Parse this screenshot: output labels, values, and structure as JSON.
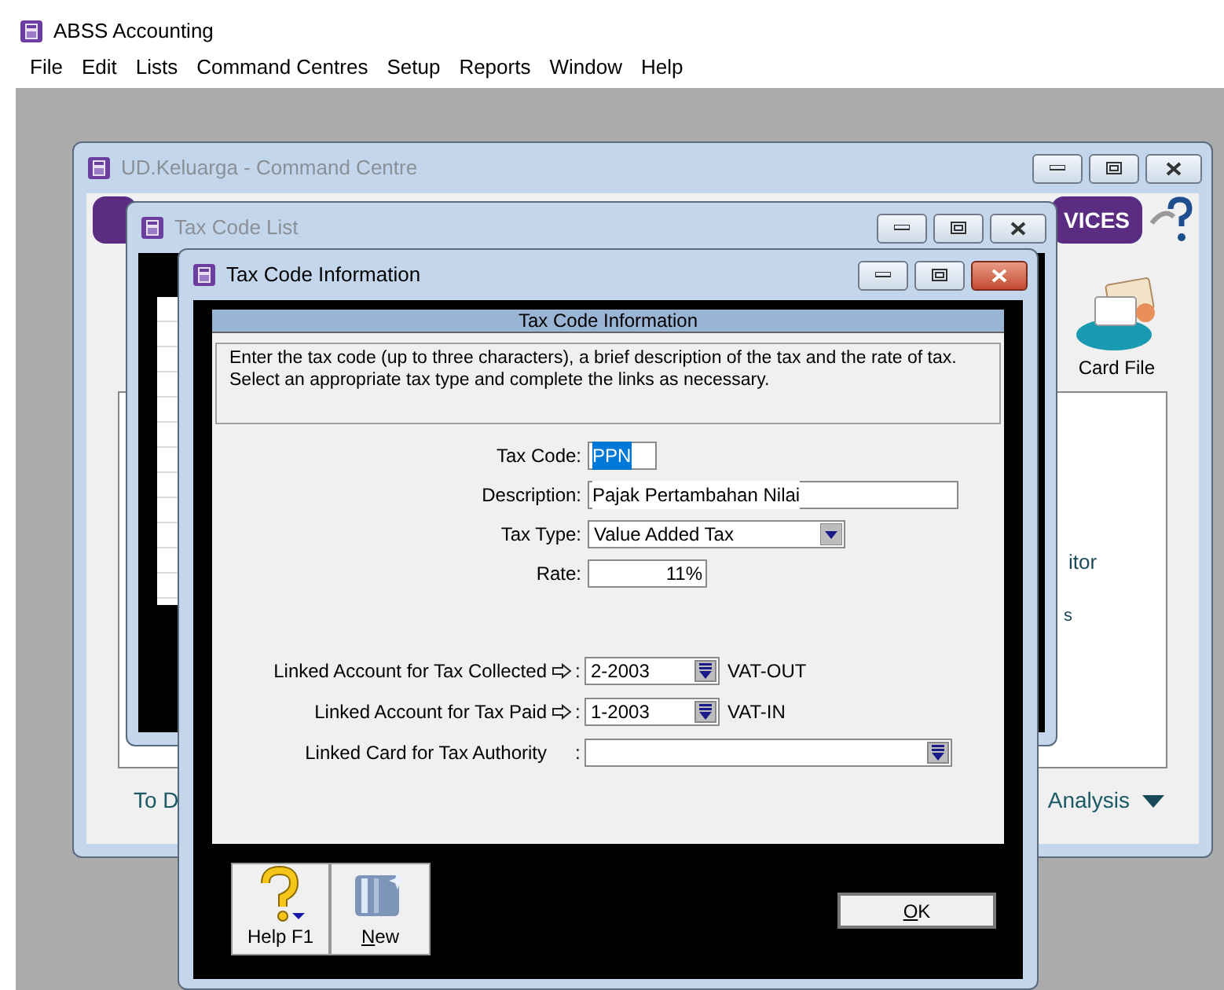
{
  "app": {
    "title": "ABSS Accounting"
  },
  "menu": [
    {
      "label": "File"
    },
    {
      "label": "Edit"
    },
    {
      "label": "Lists"
    },
    {
      "label": "Command Centres"
    },
    {
      "label": "Setup"
    },
    {
      "label": "Reports"
    },
    {
      "label": "Window"
    },
    {
      "label": "Help"
    }
  ],
  "command_centre": {
    "title": "UD.Keluarga - Command Centre",
    "active": false,
    "banner_text": "VICES",
    "card_file_label": "Card File",
    "partial_texts": [
      "itor",
      "s"
    ],
    "footer_left": "To D",
    "footer_right": "Analysis"
  },
  "tax_code_list": {
    "title": "Tax Code List",
    "active": false
  },
  "dialog": {
    "title": "Tax Code Information",
    "active": true,
    "header": "Tax Code Information",
    "instructions": "Enter the tax code (up to three characters), a brief description of the tax and the rate of tax.\nSelect an appropriate tax type and complete the links as necessary.",
    "fields": [
      {
        "label": "Tax Code:",
        "kind": "text",
        "value": "PPN",
        "highlighted": true
      },
      {
        "label": "Description:",
        "kind": "text",
        "value": "Pajak Pertambahan Nilai",
        "highlighted": false
      },
      {
        "label": "Tax Type:",
        "kind": "select",
        "value": "Value Added Tax"
      },
      {
        "label": "Rate:",
        "kind": "number",
        "value": "11%"
      }
    ],
    "links": [
      {
        "label": "Linked Account for Tax Collected",
        "arrow": true,
        "separator": ":",
        "value": "2-2003",
        "name": "VAT-OUT"
      },
      {
        "label": "Linked Account for Tax Paid",
        "arrow": true,
        "separator": ":",
        "value": "1-2003",
        "name": "VAT-IN"
      },
      {
        "label": "Linked Card for Tax Authority",
        "arrow": false,
        "separator": ":"
      }
    ],
    "help_button": {
      "label": "Help F1"
    },
    "new_button": {
      "label": "New",
      "mnemonic": true
    },
    "ok_button": {
      "label": "OK",
      "mnemonic": true
    }
  }
}
